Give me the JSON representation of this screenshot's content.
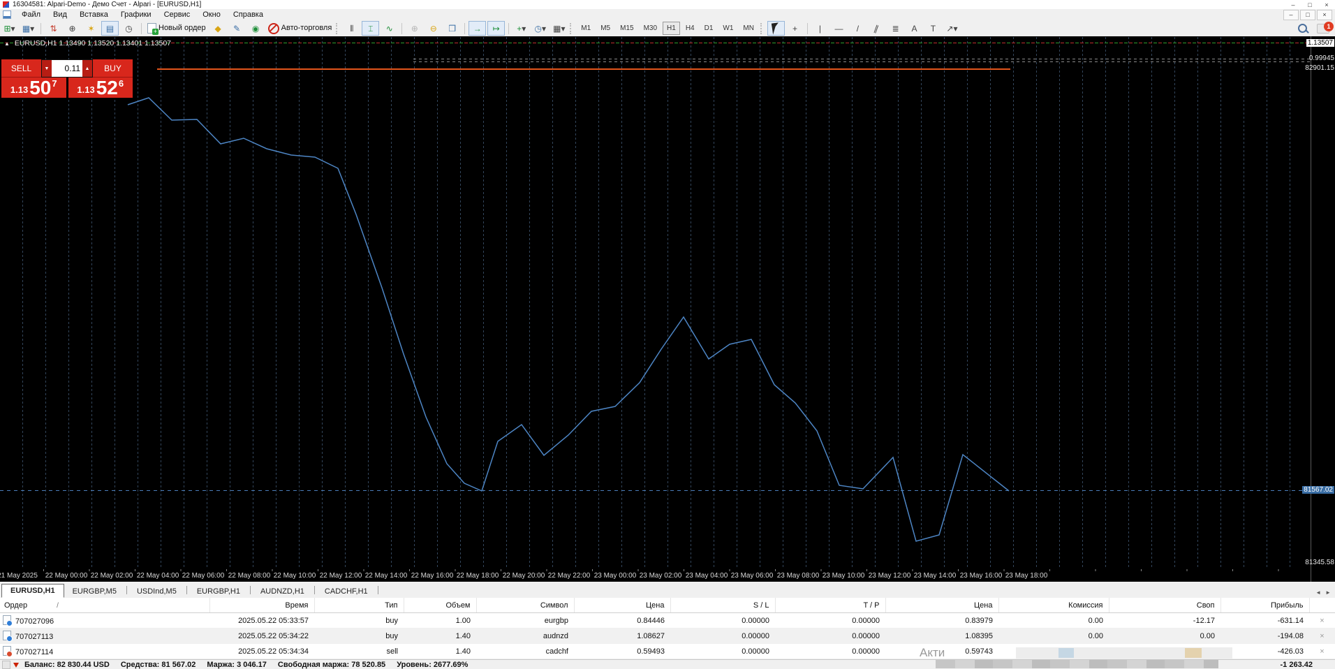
{
  "window": {
    "title": "16304581: Alpari-Demo - Демо Счет - Alpari - [EURUSD,H1]",
    "controls": {
      "minimize": "‒",
      "maximize": "□",
      "close": "×"
    }
  },
  "menubar": {
    "items": [
      "Файл",
      "Вид",
      "Вставка",
      "Графики",
      "Сервис",
      "Окно",
      "Справка"
    ]
  },
  "toolbar": {
    "new_order_label": "Новый ордер",
    "autotrade_label": "Авто-торговля",
    "timeframes": [
      "M1",
      "M5",
      "M15",
      "M30",
      "H1",
      "H4",
      "D1",
      "W1",
      "MN"
    ],
    "active_timeframe": "H1",
    "notification_count": "1",
    "icons": {
      "dropdown": "▾",
      "new_chart": "⊞",
      "profiles": "▦",
      "market_watch": "⇅",
      "data_window": "⊕",
      "navigator": "✶",
      "terminal": "▤",
      "tester": "◷",
      "plus": "+",
      "megaphone": "◆",
      "metaeditor": "✎",
      "signals": "◉",
      "zoom_in": "⊕",
      "zoom_out": "⊖",
      "tile": "❒",
      "autoscroll": "→",
      "shift": "↦",
      "indicators": "+",
      "periods": "◷",
      "templates": "▦",
      "crosshair": "+",
      "vline": "|",
      "hline": "—",
      "trend": "/",
      "channel": "∥",
      "fibo": "≣",
      "text_tool": "A",
      "label_tool": "T",
      "arrows_tool": "↗",
      "bars": "⫴",
      "candles": "⌶",
      "linechart": "∿"
    }
  },
  "chart": {
    "ohlc_arrow": "▲",
    "ohlc_label": "EURUSD,H1  1.13490 1.13520 1.13401 1.13507",
    "trade_widget": {
      "sell": "SELL",
      "buy": "BUY",
      "volume": "0.11",
      "spin_up": "▲",
      "spin_down": "▼",
      "bid_prefix": "1.13",
      "bid_main": "50",
      "bid_sup": "7",
      "ask_prefix": "1.13",
      "ask_main": "52",
      "ask_sup": "6"
    },
    "y_axis": {
      "current_price": "1.13507",
      "level2": "0.99945",
      "level3": "82901.15",
      "equity_level": "81567.02",
      "bottom_level": "81345.58"
    },
    "x_labels": [
      "21 May 2025",
      "22 May 00:00",
      "22 May 02:00",
      "22 May 04:00",
      "22 May 06:00",
      "22 May 08:00",
      "22 May 10:00",
      "22 May 12:00",
      "22 May 14:00",
      "22 May 16:00",
      "22 May 18:00",
      "22 May 20:00",
      "22 May 22:00",
      "23 May 00:00",
      "23 May 02:00",
      "23 May 04:00",
      "23 May 06:00",
      "23 May 08:00",
      "23 May 10:00",
      "23 May 12:00",
      "23 May 14:00",
      "23 May 16:00",
      "23 May 18:00"
    ],
    "colors": {
      "bg": "#000000",
      "grid": "#33465c",
      "line": "#4d85c4",
      "balance_line": "#e2551b",
      "equity_dash": "#4a7ebb",
      "equity_badge_bg": "#3a6ea5",
      "widget_red": "#d8271c"
    },
    "line_points": "183,98 213,88 246,120 282,119 316,154 349,146 382,161 417,170 451,173 484,189 510,255 547,360 578,455 610,545 640,612 665,640 690,651 713,580 747,556 779,600 814,571 847,537 881,530 916,496 947,448 979,402 1015,462 1045,441 1076,434 1109,499 1139,525 1170,565 1202,643 1236,648 1279,603 1312,723 1345,714 1379,599 1445,651"
  },
  "chart_data": {
    "type": "line",
    "title": "Equity curve overlay on EURUSD,H1 (USD)",
    "x_range": "22 May 2025 02:00 - 23 May 2025 19:00, H1 bars",
    "values": [
      82784,
      82806,
      82736,
      82738,
      82661,
      82679,
      82646,
      82626,
      82619,
      82584,
      82439,
      82208,
      81999,
      81801,
      81654,
      81592,
      81568,
      81724,
      81777,
      81680,
      81744,
      81819,
      81834,
      81909,
      82014,
      82116,
      81984,
      82030,
      82045,
      81902,
      81845,
      81757,
      81585,
      81574,
      81673,
      81409,
      81429,
      81682,
      81567
    ],
    "levels": {
      "balance_line": 82830.44,
      "equity_line": 81567.02,
      "scale_top": 82901.15,
      "scale_bottom": 81345.58
    },
    "ylim": [
      81345.58,
      82901.15
    ],
    "grid": "vertical dashed",
    "legend": "none"
  },
  "tabs": {
    "prev": "◄",
    "next": "►",
    "items": [
      {
        "label": "EURUSD,H1",
        "active": true
      },
      {
        "label": "EURGBP,M5",
        "active": false
      },
      {
        "label": "USDInd,M5",
        "active": false
      },
      {
        "label": "EURGBP,H1",
        "active": false
      },
      {
        "label": "AUDNZD,H1",
        "active": false
      },
      {
        "label": "CADCHF,H1",
        "active": false
      }
    ]
  },
  "orders": {
    "sort_glyph": "/",
    "columns": [
      "Ордер",
      "Время",
      "Тип",
      "Объем",
      "Символ",
      "Цена",
      "S / L",
      "T / P",
      "Цена",
      "Комиссия",
      "Своп",
      "Прибыль"
    ],
    "rows": [
      {
        "close": "×",
        "cells": [
          "707027096",
          "2025.05.22 05:33:57",
          "buy",
          "1.00",
          "eurgbp",
          "0.84446",
          "0.00000",
          "0.00000",
          "0.83979",
          "0.00",
          "-12.17",
          "-631.14"
        ]
      },
      {
        "close": "×",
        "cells": [
          "707027113",
          "2025.05.22 05:34:22",
          "buy",
          "1.40",
          "audnzd",
          "1.08627",
          "0.00000",
          "0.00000",
          "1.08395",
          "0.00",
          "0.00",
          "-194.08"
        ]
      },
      {
        "close": "×",
        "cells": [
          "707027114",
          "2025.05.22 05:34:34",
          "sell",
          "1.40",
          "cadchf",
          "0.59493",
          "0.00000",
          "0.00000",
          "0.59743",
          "",
          "",
          "-426.03"
        ]
      }
    ]
  },
  "statusbar": {
    "balance": "Баланс: 82 830.44 USD",
    "equity": "Средства: 81 567.02",
    "margin": "Маржа: 3 046.17",
    "free_margin": "Свободная маржа: 78 520.85",
    "level": "Уровень: 2677.69%",
    "total_profit": "-1 263.42"
  },
  "watermark": {
    "text": "Акти"
  }
}
